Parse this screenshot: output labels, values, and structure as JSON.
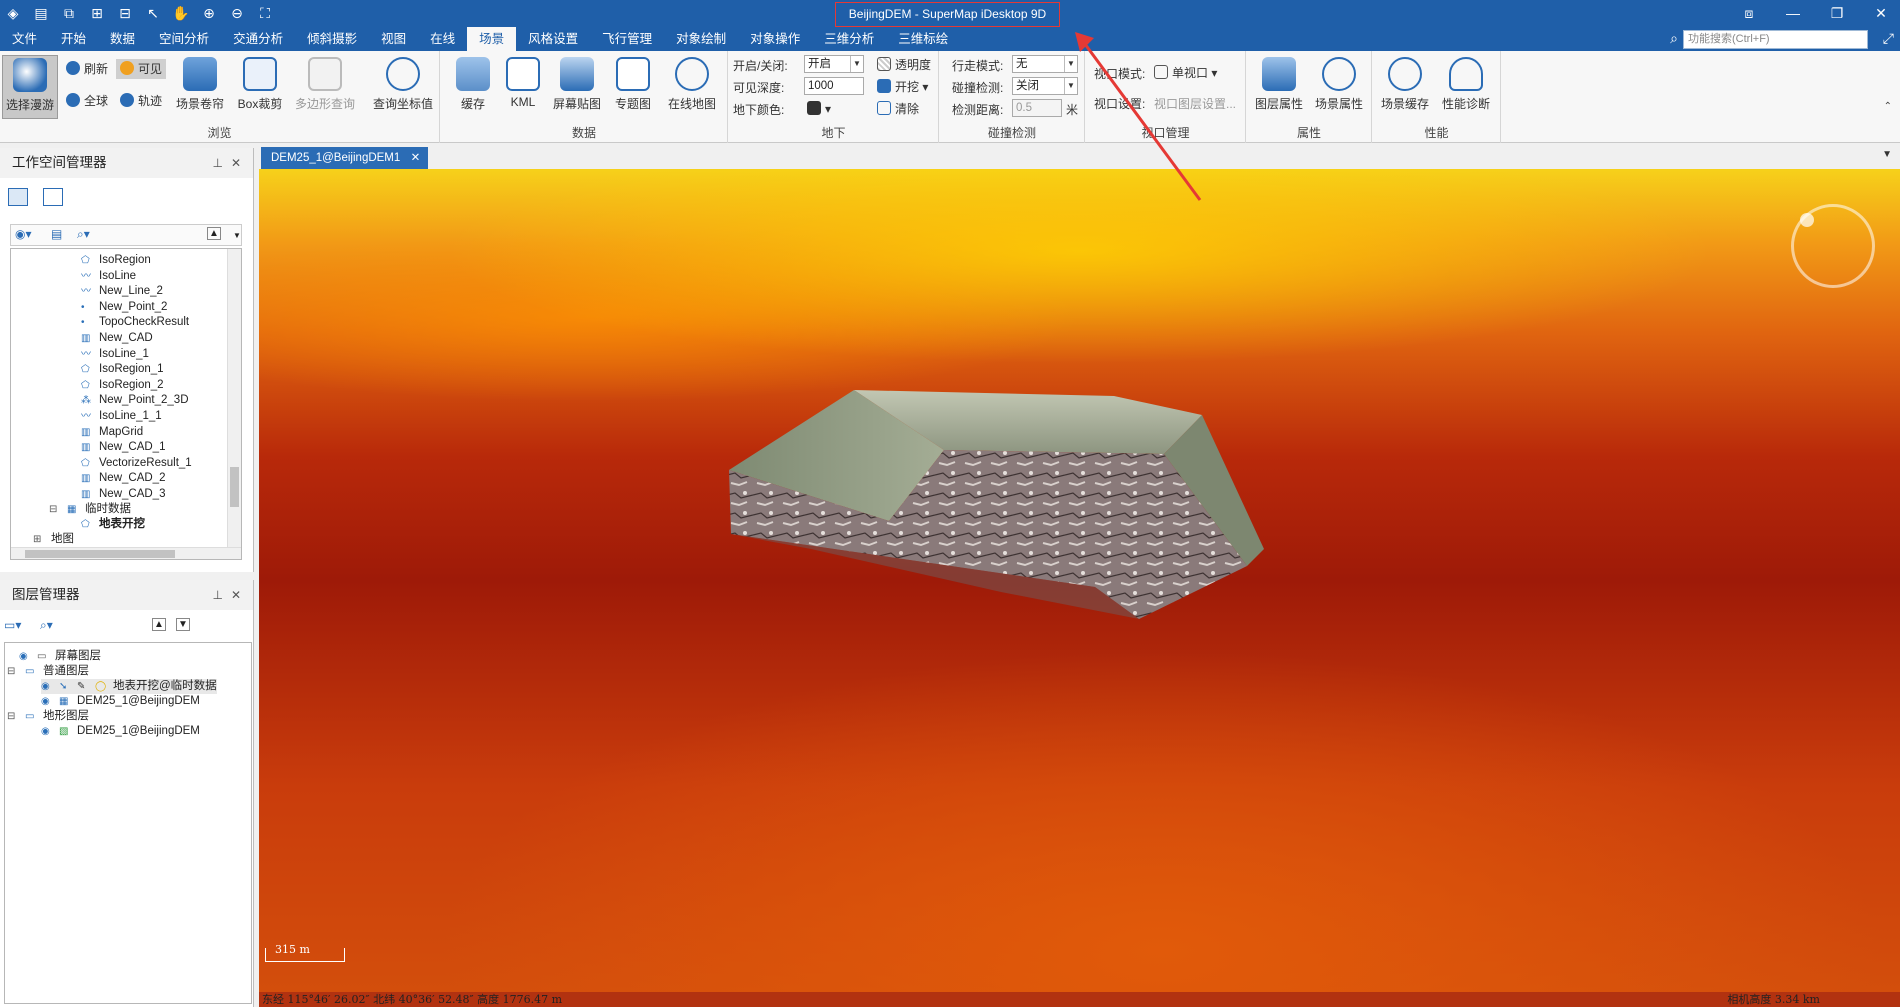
{
  "window": {
    "title": "BeijingDEM - SuperMap iDesktop 9D"
  },
  "menu": [
    "文件",
    "开始",
    "数据",
    "空间分析",
    "交通分析",
    "倾斜摄影",
    "视图",
    "在线",
    "场景",
    "风格设置",
    "飞行管理",
    "对象绘制",
    "对象操作",
    "三维分析",
    "三维标绘"
  ],
  "menu_active": "场景",
  "search": {
    "placeholder": "功能搜索(Ctrl+F)"
  },
  "ribbon": {
    "browse": {
      "label": "浏览",
      "select_roam": "选择漫游",
      "refresh": "刷新",
      "visible": "可见",
      "full_globe": "全球",
      "track": "轨迹",
      "scene_shutter": "场景卷帘",
      "box_clip": "Box裁剪",
      "polygon_query": "多边形查询",
      "query_coord": "查询坐标值"
    },
    "data": {
      "label": "数据",
      "cache": "缓存",
      "kml": "KML",
      "screen_paste": "屏幕贴图",
      "thematic": "专题图",
      "online_map": "在线地图"
    },
    "underground": {
      "label": "地下",
      "on_off_label": "开启/关闭:",
      "on_off_value": "开启",
      "visible_depth_label": "可见深度:",
      "visible_depth_value": "1000",
      "underground_color_label": "地下颜色:",
      "transparency": "透明度",
      "excavate": "开挖",
      "clear": "清除"
    },
    "collision": {
      "label": "碰撞检测",
      "walk_mode_label": "行走模式:",
      "walk_mode_value": "无",
      "collision_label": "碰撞检测:",
      "collision_value": "关闭",
      "distance_label": "检测距离:",
      "distance_value": "0.5",
      "distance_unit": "米"
    },
    "viewport": {
      "label": "视口管理",
      "mode_label": "视口模式:",
      "mode_value": "单视口",
      "settings_label": "视口设置:",
      "settings_value": "视口图层设置..."
    },
    "properties": {
      "label": "属性",
      "layer_props": "图层属性",
      "scene_props": "场景属性"
    },
    "performance": {
      "label": "性能",
      "scene_cache": "场景缓存",
      "diagnose": "性能诊断"
    }
  },
  "workspace": {
    "title": "工作空间管理器",
    "items": [
      "IsoRegion",
      "IsoLine",
      "New_Line_2",
      "New_Point_2",
      "TopoCheckResult",
      "New_CAD",
      "IsoLine_1",
      "IsoRegion_1",
      "IsoRegion_2",
      "New_Point_2_3D",
      "IsoLine_1_1",
      "MapGrid",
      "New_CAD_1",
      "VectorizeResult_1",
      "New_CAD_2",
      "New_CAD_3"
    ],
    "temp_group": "临时数据",
    "temp_item": "地表开挖",
    "maps_group": "地图"
  },
  "layers": {
    "title": "图层管理器",
    "screen": "屏幕图层",
    "normal": "普通图层",
    "excavation_layer": "地表开挖@临时数据",
    "dem_grid": "DEM25_1@BeijingDEM",
    "terrain": "地形图层",
    "dem_terrain": "DEM25_1@BeijingDEM"
  },
  "document": {
    "tab": "DEM25_1@BeijingDEM1"
  },
  "scale": {
    "text": "315 m"
  },
  "status": {
    "coords": "东经 115°46′ 26.02″  北纬 40°36′ 52.48″  高度 1776.47 m",
    "camera": "相机高度 3.34 km"
  }
}
